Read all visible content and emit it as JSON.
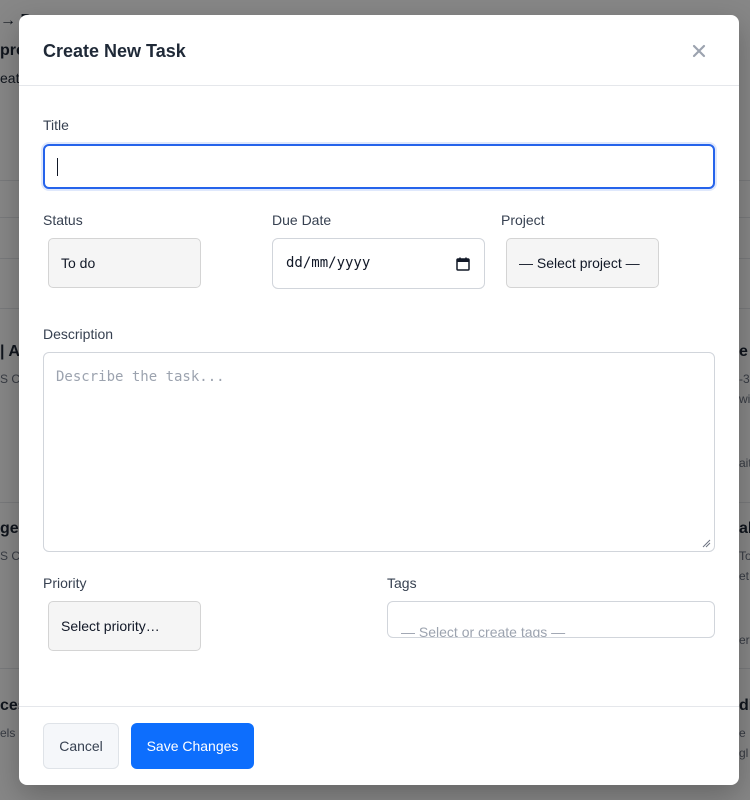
{
  "modal": {
    "title": "Create New Task",
    "close_symbol": "×",
    "fields": {
      "title_label": "Title",
      "title_value": "",
      "status_label": "Status",
      "status_value": "To do",
      "due_date_label": "Due Date",
      "due_date_value": "dd/mm/yyyy",
      "project_label": "Project",
      "project_value": "— Select project —",
      "description_label": "Description",
      "description_placeholder": "Describe the task...",
      "priority_label": "Priority",
      "priority_value": "Select priority…",
      "tags_label": "Tags",
      "tags_placeholder": "— Select or create tags —"
    },
    "footer": {
      "cancel_label": "Cancel",
      "save_label": "Save Changes"
    }
  },
  "background": {
    "fragments": [
      "→ D",
      "pro",
      "eat",
      "| Ac",
      "S Ca",
      "ge",
      "S Ca",
      "ces",
      "els i",
      "e",
      "-3",
      "wi",
      "ait",
      "al",
      "Top",
      "et",
      "er",
      "di",
      "e",
      "gl"
    ]
  },
  "colors": {
    "primary": "#0d6efd",
    "focus_border": "#2563eb",
    "overlay": "rgba(0,0,0,0.47)"
  },
  "icons": {
    "close": "close-icon",
    "calendar": "calendar-icon",
    "resize": "resize-handle-icon"
  }
}
